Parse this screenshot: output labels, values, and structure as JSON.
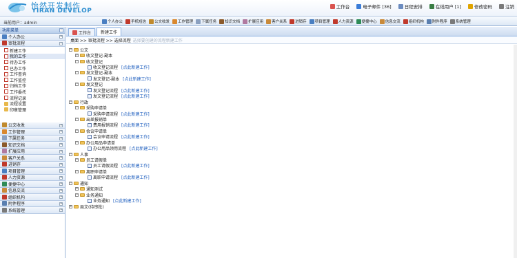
{
  "header": {
    "brand_cn": "怡然开发制作",
    "brand_en": "YIRAN DEVELOP",
    "nav": [
      {
        "label": "工作台",
        "icon": "home-icon",
        "color": "#d9534f"
      },
      {
        "label": "电子邮件 [36]",
        "icon": "mail-icon",
        "color": "#3b7dd8"
      },
      {
        "label": "日程安排",
        "icon": "calendar-icon",
        "color": "#6b8bbf"
      },
      {
        "label": "在线用户 [1]",
        "icon": "user-icon",
        "color": "#3a7d44"
      },
      {
        "label": "修改密码",
        "icon": "key-icon",
        "color": "#e0a400"
      },
      {
        "label": "注销",
        "icon": "logout-icon",
        "color": "#7a7a7a"
      }
    ]
  },
  "toolbar": {
    "user_label": "当前用户：admin",
    "items": [
      {
        "label": "个人办公",
        "color": "#4a7fc1"
      },
      {
        "label": "手机短信",
        "color": "#c0392b"
      },
      {
        "label": "公文收发",
        "color": "#c08a2e"
      },
      {
        "label": "工作管理",
        "color": "#d9882e"
      },
      {
        "label": "下属任务",
        "color": "#8aa0c0"
      },
      {
        "label": "知识文档",
        "color": "#8b5a2b"
      },
      {
        "label": "扩展应用",
        "color": "#b07aa0"
      },
      {
        "label": "客户关系",
        "color": "#c98a3a"
      },
      {
        "label": "进销存",
        "color": "#c0392b"
      },
      {
        "label": "项目管理",
        "color": "#4a7fc1"
      },
      {
        "label": "人力资源",
        "color": "#c0392b"
      },
      {
        "label": "便捷中心",
        "color": "#2e8b57"
      },
      {
        "label": "信息交流",
        "color": "#c98a3a"
      },
      {
        "label": "组织机构",
        "color": "#c0392b"
      },
      {
        "label": "附件程序",
        "color": "#5a7fb0"
      },
      {
        "label": "系统管理",
        "color": "#7a7a7a"
      }
    ]
  },
  "sidebar": {
    "title": "功能菜单",
    "top_categories": [
      {
        "label": "个人办公",
        "btn": "+"
      },
      {
        "label": "审批流程",
        "btn": "−"
      }
    ],
    "sub_items": [
      {
        "label": "新建工作",
        "type": "doc",
        "selected": false
      },
      {
        "label": "我的工作",
        "type": "doc",
        "selected": true
      },
      {
        "label": "待办工作",
        "type": "doc",
        "selected": false
      },
      {
        "label": "已办工作",
        "type": "doc",
        "selected": false
      },
      {
        "label": "工作查询",
        "type": "doc",
        "selected": false
      },
      {
        "label": "工作监控",
        "type": "doc",
        "selected": false
      },
      {
        "label": "归档工作",
        "type": "doc",
        "selected": false
      },
      {
        "label": "工作委托",
        "type": "doc",
        "selected": false
      },
      {
        "label": "流程记录",
        "type": "doc",
        "selected": false
      },
      {
        "label": "流程设置",
        "type": "grp",
        "selected": false
      },
      {
        "label": "印章管理",
        "type": "grp",
        "selected": false
      }
    ],
    "bottom_categories": [
      {
        "label": "公文收发",
        "color": "#c08a2e"
      },
      {
        "label": "工作管理",
        "color": "#d9882e"
      },
      {
        "label": "下属任务",
        "color": "#8aa0c0"
      },
      {
        "label": "知识文档",
        "color": "#8b5a2b"
      },
      {
        "label": "扩展应用",
        "color": "#b07aa0"
      },
      {
        "label": "客户关系",
        "color": "#c98a3a"
      },
      {
        "label": "进销存",
        "color": "#c0392b"
      },
      {
        "label": "项目管理",
        "color": "#4a7fc1"
      },
      {
        "label": "人力资源",
        "color": "#c0392b"
      },
      {
        "label": "便捷中心",
        "color": "#2e8b57"
      },
      {
        "label": "信息交流",
        "color": "#c98a3a"
      },
      {
        "label": "组织机构",
        "color": "#c0392b"
      },
      {
        "label": "附件程序",
        "color": "#5a7fb0"
      },
      {
        "label": "系统管理",
        "color": "#7a7a7a"
      }
    ]
  },
  "tabs": [
    {
      "label": "工作台",
      "icon": "home-icon",
      "active": false
    },
    {
      "label": "新建工作",
      "icon": "",
      "active": true
    }
  ],
  "breadcrumb": {
    "text": "桌面 >> 审批流程 >> 选择流程",
    "hint": "选择要创建的流程新建工作"
  },
  "new_work_label": "[点此新建工作]",
  "tree": [
    {
      "level": 0,
      "label": "公文",
      "kind": "folder",
      "toggle": "−"
    },
    {
      "level": 1,
      "label": "收文登记-副本",
      "kind": "folder",
      "toggle": "+"
    },
    {
      "level": 1,
      "label": "收文登记",
      "kind": "folder",
      "toggle": "−"
    },
    {
      "level": 2,
      "label": "收文登记流程",
      "kind": "flow",
      "link": true
    },
    {
      "level": 1,
      "label": "发文登记-副本",
      "kind": "folder",
      "toggle": "−"
    },
    {
      "level": 2,
      "label": "发文登记-副本",
      "kind": "flow",
      "link": true
    },
    {
      "level": 1,
      "label": "发文登记",
      "kind": "folder",
      "toggle": "−"
    },
    {
      "level": 2,
      "label": "发文登记流程",
      "kind": "flow",
      "link": true
    },
    {
      "level": 2,
      "label": "发文登记流程",
      "kind": "flow",
      "link": true
    },
    {
      "level": 0,
      "label": "行政",
      "kind": "folder",
      "toggle": "−"
    },
    {
      "level": 1,
      "label": "采购申请单",
      "kind": "folder",
      "toggle": "−"
    },
    {
      "level": 2,
      "label": "采购申请流程",
      "kind": "flow",
      "link": true
    },
    {
      "level": 1,
      "label": "出差报销单",
      "kind": "folder",
      "toggle": "−"
    },
    {
      "level": 2,
      "label": "费用报销流程",
      "kind": "flow",
      "link": true
    },
    {
      "level": 1,
      "label": "会议申请单",
      "kind": "folder",
      "toggle": "−"
    },
    {
      "level": 2,
      "label": "会议申请流程",
      "kind": "flow",
      "link": true
    },
    {
      "level": 1,
      "label": "办公用品申请单",
      "kind": "folder",
      "toggle": "−"
    },
    {
      "level": 2,
      "label": "办公用品领用流程",
      "kind": "flow",
      "link": true
    },
    {
      "level": 0,
      "label": "人事",
      "kind": "folder",
      "toggle": "−"
    },
    {
      "level": 1,
      "label": "员工请假单",
      "kind": "folder",
      "toggle": "−"
    },
    {
      "level": 2,
      "label": "员工请假流程",
      "kind": "flow",
      "link": true
    },
    {
      "level": 1,
      "label": "离职申请单",
      "kind": "folder",
      "toggle": "−"
    },
    {
      "level": 2,
      "label": "离职申请流程",
      "kind": "flow",
      "link": true
    },
    {
      "level": 0,
      "label": "通知",
      "kind": "folder",
      "toggle": "−"
    },
    {
      "level": 1,
      "label": "通知测试",
      "kind": "folder",
      "toggle": "+"
    },
    {
      "level": 1,
      "label": "业务通知",
      "kind": "folder",
      "toggle": "−"
    },
    {
      "level": 2,
      "label": "业务通知",
      "kind": "flow",
      "link": true
    },
    {
      "level": 0,
      "label": "局文(待审批)",
      "kind": "folder",
      "toggle": "+"
    }
  ]
}
